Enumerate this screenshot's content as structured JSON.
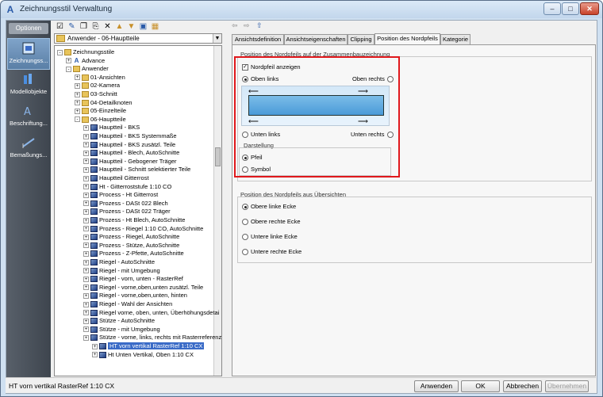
{
  "window": {
    "title": "Zeichnungsstil Verwaltung"
  },
  "left_bar": {
    "options_label": "Optionen",
    "items": [
      {
        "label": "Zeichnungss...",
        "icon": "drawing-style-icon",
        "active": true
      },
      {
        "label": "Modellobjekte",
        "icon": "model-objects-icon",
        "active": false
      },
      {
        "label": "Beschriftung...",
        "icon": "annotation-icon",
        "active": false
      },
      {
        "label": "Bemaßungs...",
        "icon": "dimension-icon",
        "active": false
      }
    ]
  },
  "toolbar": {
    "icons": [
      "checkbox-icon",
      "new-icon",
      "copy-icon",
      "paste-icon",
      "delete-icon",
      "folder-import-icon",
      "export-icon",
      "edit-icon",
      "folder-icon"
    ]
  },
  "dropdown": {
    "value": "Anwender - 06-Hauptteile"
  },
  "tree": {
    "items": [
      {
        "label": "Zeichnungsstile",
        "level": 0,
        "exp": "-",
        "icon": "folder"
      },
      {
        "label": "Advance",
        "level": 1,
        "exp": "+",
        "icon": "adv"
      },
      {
        "label": "Anwender",
        "level": 1,
        "exp": "-",
        "icon": "folder"
      },
      {
        "label": "01-Ansichten",
        "level": 2,
        "exp": "+",
        "icon": "folder"
      },
      {
        "label": "02-Kamera",
        "level": 2,
        "exp": "+",
        "icon": "folder"
      },
      {
        "label": "03-Schnitt",
        "level": 2,
        "exp": "+",
        "icon": "folder"
      },
      {
        "label": "04-Detailknoten",
        "level": 2,
        "exp": "+",
        "icon": "folder"
      },
      {
        "label": "05-Einzelteile",
        "level": 2,
        "exp": "+",
        "icon": "folder"
      },
      {
        "label": "06-Hauptteile",
        "level": 2,
        "exp": "-",
        "icon": "folder"
      },
      {
        "label": "Hauptteil - BKS",
        "level": 3,
        "exp": "+",
        "icon": "style"
      },
      {
        "label": "Hauptteil - BKS Systemmaße",
        "level": 3,
        "exp": "+",
        "icon": "style"
      },
      {
        "label": "Hauptteil - BKS zusätzl. Teile",
        "level": 3,
        "exp": "+",
        "icon": "style"
      },
      {
        "label": "Hauptteil - Blech, AutoSchnitte",
        "level": 3,
        "exp": "+",
        "icon": "style"
      },
      {
        "label": "Hauptteil - Gebogener Träger",
        "level": 3,
        "exp": "+",
        "icon": "style"
      },
      {
        "label": "Hauptteil - Schnitt selektierter Teile",
        "level": 3,
        "exp": "+",
        "icon": "style"
      },
      {
        "label": "Hauptteil Gitterrost",
        "level": 3,
        "exp": "+",
        "icon": "style"
      },
      {
        "label": "Ht - Gitterroststufe 1:10 CO",
        "level": 3,
        "exp": "+",
        "icon": "style"
      },
      {
        "label": "Process - Ht Gitterrost",
        "level": 3,
        "exp": "+",
        "icon": "style"
      },
      {
        "label": "Prozess - DASt 022 Blech",
        "level": 3,
        "exp": "+",
        "icon": "style"
      },
      {
        "label": "Prozess - DASt 022 Träger",
        "level": 3,
        "exp": "+",
        "icon": "style"
      },
      {
        "label": "Prozess - Ht Blech, AutoSchnitte",
        "level": 3,
        "exp": "+",
        "icon": "style"
      },
      {
        "label": "Prozess - Riegel 1:10 CO, AutoSchnitte",
        "level": 3,
        "exp": "+",
        "icon": "style"
      },
      {
        "label": "Prozess - Riegel, AutoSchnitte",
        "level": 3,
        "exp": "+",
        "icon": "style"
      },
      {
        "label": "Prozess - Stütze, AutoSchnitte",
        "level": 3,
        "exp": "+",
        "icon": "style"
      },
      {
        "label": "Prozess - Z-Pfette, AutoSchnitte",
        "level": 3,
        "exp": "+",
        "icon": "style"
      },
      {
        "label": "Riegel - AutoSchnitte",
        "level": 3,
        "exp": "+",
        "icon": "style"
      },
      {
        "label": "Riegel - mit Umgebung",
        "level": 3,
        "exp": "+",
        "icon": "style"
      },
      {
        "label": "Riegel - vorn, unten - RasterRef",
        "level": 3,
        "exp": "+",
        "icon": "style"
      },
      {
        "label": "Riegel - vorne,oben,unten zusätzl. Teile",
        "level": 3,
        "exp": "+",
        "icon": "style"
      },
      {
        "label": "Riegel - vorne,oben,unten, hinten",
        "level": 3,
        "exp": "+",
        "icon": "style"
      },
      {
        "label": "Riegel - Wahl der Ansichten",
        "level": 3,
        "exp": "+",
        "icon": "style"
      },
      {
        "label": "Riegel vorne, oben, unten, Überhöhungsdetai",
        "level": 3,
        "exp": "+",
        "icon": "style"
      },
      {
        "label": "Stütze - AutoSchnitte",
        "level": 3,
        "exp": "+",
        "icon": "style"
      },
      {
        "label": "Stütze - mit Umgebung",
        "level": 3,
        "exp": "+",
        "icon": "style"
      },
      {
        "label": "Stütze - vorne, links, rechts mit Rasterreferenz",
        "level": 3,
        "exp": "+",
        "icon": "style"
      },
      {
        "label": "HT vorn vertikal RasterRef 1:10 CX",
        "level": 4,
        "exp": "+",
        "icon": "style",
        "selected": true
      },
      {
        "label": "Ht Unten Vertikal, Oben 1:10 CX",
        "level": 4,
        "exp": "+",
        "icon": "style"
      }
    ]
  },
  "nav": {
    "back": "⇦",
    "forward": "⇨",
    "up": "⇧"
  },
  "tabs": [
    {
      "label": "Ansichtsdefinition",
      "active": false
    },
    {
      "label": "Ansichtseigenschaften",
      "active": false
    },
    {
      "label": "Clipping",
      "active": false
    },
    {
      "label": "Position des Nordpfeils",
      "active": true
    },
    {
      "label": "Kategorie",
      "active": false
    }
  ],
  "panel": {
    "group1": {
      "title": "Position des Nordpfeils auf der Zusammenbauzeichnung",
      "checkbox_label": "Nordpfeil anzeigen",
      "checkbox_checked": true,
      "top_left": "Oben links",
      "top_right": "Oben rechts",
      "bottom_left": "Unten links",
      "bottom_right": "Unten rechts",
      "selected_corner": "Oben links",
      "darstellung_title": "Darstellung",
      "opt_pfeil": "Pfeil",
      "opt_symbol": "Symbol",
      "selected_darstellung": "Pfeil"
    },
    "group2": {
      "title": "Position des Nordpfeils aus Übersichten",
      "options": [
        "Obere linke Ecke",
        "Obere rechte Ecke",
        "Untere linke Ecke",
        "Untere rechte Ecke"
      ],
      "selected": "Obere linke Ecke"
    }
  },
  "status": {
    "text": "HT vorn vertikal RasterRef 1:10 CX"
  },
  "buttons": {
    "apply": "Anwenden",
    "ok": "OK",
    "cancel": "Abbrechen",
    "take_over": "Übernehmen"
  },
  "colors": {
    "highlight": "#e0181c",
    "selection": "#3a6bc7"
  }
}
